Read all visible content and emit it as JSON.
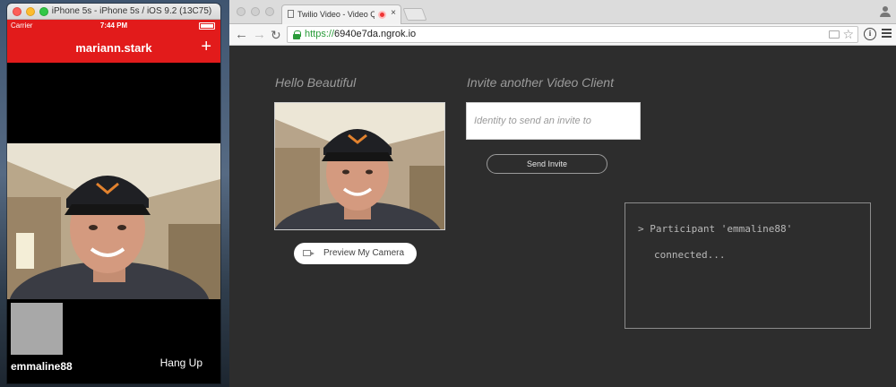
{
  "simulator": {
    "window_title": "iPhone 5s - iPhone 5s / iOS 9.2 (13C75)",
    "carrier": "Carrier",
    "time": "7:44 PM",
    "nav_title": "mariann.stark",
    "add_icon": "+",
    "participant_name": "emmaline88",
    "hang_up_label": "Hang Up",
    "header_color": "#e21b1b"
  },
  "browser": {
    "tab_title": "Twilio Video - Video Qu",
    "tab_close": "×",
    "url_scheme": "https://",
    "url_host": "6940e7da.ngrok.io",
    "icons": [
      "back-arrow-icon",
      "forward-arrow-icon",
      "reload-icon",
      "lock-icon",
      "cast-icon",
      "star-icon",
      "info-icon",
      "menu-icon",
      "profile-icon"
    ]
  },
  "page": {
    "hello_heading": "Hello Beautiful",
    "invite_heading": "Invite another Video Client",
    "invite_placeholder": "Identity to send an invite to",
    "send_invite_label": "Send Invite",
    "preview_camera_label": "Preview My Camera",
    "log_line1": "> Participant 'emmaline88'",
    "log_line2": "connected..."
  }
}
